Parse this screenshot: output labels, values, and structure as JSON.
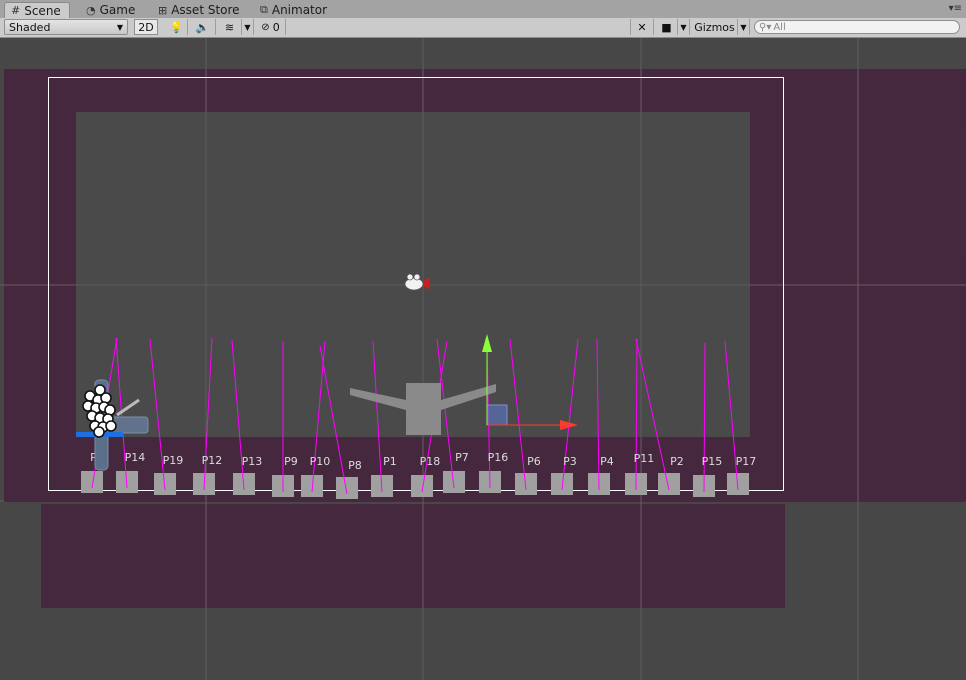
{
  "tabs": [
    {
      "label": "Scene",
      "icon": "grid-icon"
    },
    {
      "label": "Game",
      "icon": "pacman-icon"
    },
    {
      "label": "Asset Store",
      "icon": "store-icon"
    },
    {
      "label": "Animator",
      "icon": "animator-icon"
    }
  ],
  "toolbar": {
    "draw_mode": "Shaded",
    "mode_2d": "2D",
    "hidden_count": "0",
    "gizmos": "Gizmos",
    "search_placeholder": "All"
  },
  "colors": {
    "background": "#474747",
    "bounds": "#46273e",
    "camera_frame": "#ffffff",
    "inner_area": "#4a4a4a",
    "pin_line": "#ff00ff",
    "peg": "#a0a0a0",
    "gizmo_x": "#ff3b2f",
    "gizmo_y": "#8cff3c"
  },
  "scene": {
    "peg_labels": [
      "P5",
      "P14",
      "P19",
      "P12",
      "P13",
      "P9",
      "P10",
      "P8",
      "P1",
      "P18",
      "P7",
      "P16",
      "P6",
      "P3",
      "P4",
      "P11",
      "P2",
      "P15",
      "P17"
    ]
  }
}
